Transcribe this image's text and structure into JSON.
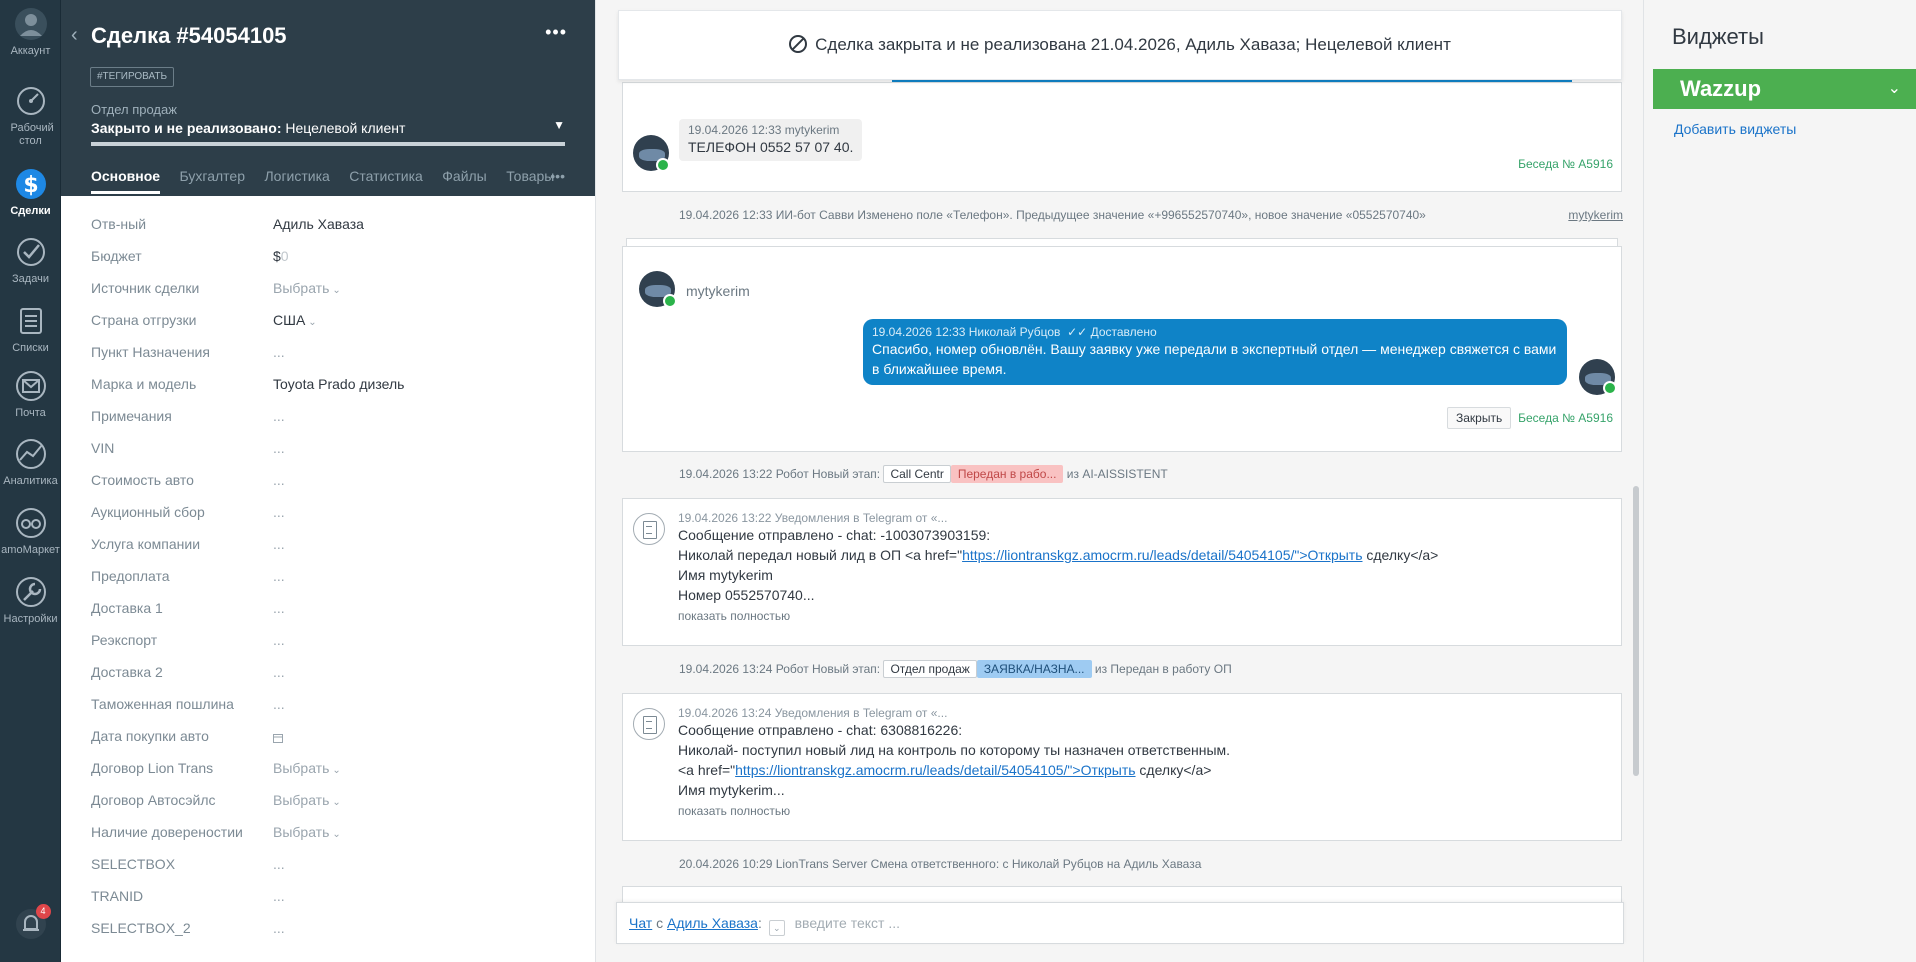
{
  "nav": {
    "account": "Аккаунт",
    "desk": "Рабочий стол",
    "deals": "Сделки",
    "tasks": "Задачи",
    "lists": "Списки",
    "mail": "Почта",
    "analytics": "Аналитика",
    "market": "amoМаркет",
    "settings": "Настройки",
    "notif_count": "4"
  },
  "deal": {
    "title": "Сделка #54054105",
    "tag_button": "#ТЕГИРОВАТЬ",
    "pipeline": "Отдел продаж",
    "stage_status": "Закрыто и не реализовано:",
    "stage_reason": "Нецелевой клиент",
    "tabs": [
      "Основное",
      "Бухгалтер",
      "Логистика",
      "Статистика",
      "Файлы",
      "Товары"
    ]
  },
  "fields": [
    {
      "label": "Отв-ный",
      "value": "Адиль Хаваза"
    },
    {
      "label": "Бюджет",
      "value": "$"
    },
    {
      "label": "Источник сделки",
      "value": "Выбрать"
    },
    {
      "label": "Страна отгрузки",
      "value": "США"
    },
    {
      "label": "Пункт Назначения",
      "value": "..."
    },
    {
      "label": "Марка и модель",
      "value": "Toyota Prado дизель"
    },
    {
      "label": "Примечания",
      "value": "..."
    },
    {
      "label": "VIN",
      "value": "..."
    },
    {
      "label": "Стоимость авто",
      "value": "..."
    },
    {
      "label": "Аукционный сбор",
      "value": "..."
    },
    {
      "label": "Услуга компании",
      "value": "..."
    },
    {
      "label": "Предоплата",
      "value": "..."
    },
    {
      "label": "Доставка 1",
      "value": "..."
    },
    {
      "label": "Реэкспорт",
      "value": "..."
    },
    {
      "label": "Доставка 2",
      "value": "..."
    },
    {
      "label": "Таможенная пошлина",
      "value": "..."
    },
    {
      "label": "Дата покупки авто",
      "value": ""
    },
    {
      "label": "Договор Lion Trans",
      "value": "Выбрать"
    },
    {
      "label": "Договор Автосэйлс",
      "value": "Выбрать"
    },
    {
      "label": "Наличие довереностии",
      "value": "Выбрать"
    },
    {
      "label": "SELECTBOX",
      "value": "..."
    },
    {
      "label": "TRANID",
      "value": "..."
    },
    {
      "label": "SELECTBOX_2",
      "value": "..."
    }
  ],
  "feed": {
    "notice": "Сделка закрыта и не реализована 21.04.2026, Адиль Хаваза; Нецелевой клиент",
    "msg1": {
      "meta": "19.04.2026 12:33 mytykerim",
      "text": "ТЕЛЕФОН 0552 57 07 40.",
      "chat": "Беседа № A5916"
    },
    "event1": {
      "text": "19.04.2026 12:33 ИИ-бот Савви Изменено поле «Телефон». Предыдущее значение «+996552570740», новое значение «0552570740»",
      "author": "mytykerim"
    },
    "thread": {
      "contact": "mytykerim",
      "out_meta": "19.04.2026 12:33 Николай Рубцов",
      "delivered": "Доставлено",
      "out_text": "Спасибо, номер обновлён. Вашу заявку уже передали в экспертный отдел — менеджер свяжется с вами в ближайшее время.",
      "close_btn": "Закрыть",
      "chat": "Беседа № A5916"
    },
    "event2": {
      "prefix": "19.04.2026 13:22 Робот Новый этап:",
      "pill1": "Call Centr",
      "pill2": "Передан в рабо...",
      "suffix": "из AI-AISSISTENT"
    },
    "tg1": {
      "meta": "19.04.2026 13:22 Уведомления в Telegram от «...",
      "line1": "Сообщение отправлено - chat: -1003073903159:",
      "line2_pre": "Николай передал новый лид в ОП <a href=\"",
      "line2_link": "https://liontranskgz.amocrm.ru/leads/detail/54054105/\">Открыть",
      "line2_post": " сделку</a>",
      "line3": "Имя mytykerim",
      "line4": "Номер 0552570740...",
      "more": "показать полностью"
    },
    "event3": {
      "prefix": "19.04.2026 13:24 Робот Новый этап:",
      "pill1": "Отдел продаж",
      "pill2": "ЗАЯВКА/НАЗНА...",
      "suffix": "из Передан в работу ОП"
    },
    "tg2": {
      "meta": "19.04.2026 13:24 Уведомления в Telegram от «...",
      "line1": "Сообщение отправлено - chat: 6308816226:",
      "line2": "Николай- поступил новый лид на контроль по которому ты назначен ответственным.",
      "line3_pre": "<a href=\"",
      "line3_link": "https://liontranskgz.amocrm.ru/leads/detail/54054105/\">Открыть",
      "line3_post": " сделку</a>",
      "line4": "Имя mytykerim...",
      "more": "показать полностью"
    },
    "event4": "20.04.2026 10:29 LionTrans Server Смена ответственного: с Николай Рубцов на Адиль Хаваза",
    "compose": {
      "chat": "Чат",
      "with": "с",
      "user": "Адиль Хаваза",
      "placeholder": "введите текст ..."
    }
  },
  "widgets": {
    "title": "Виджеты",
    "wazzup": "Wazzup",
    "add": "Добавить виджеты"
  }
}
